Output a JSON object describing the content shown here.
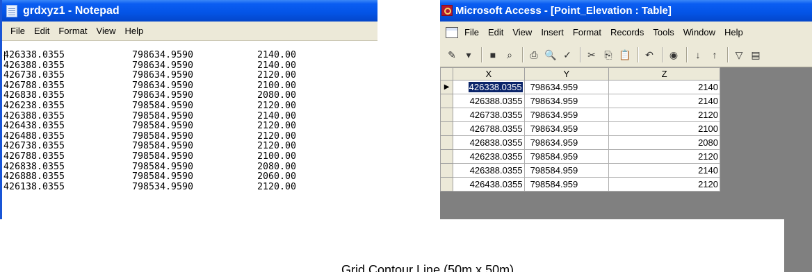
{
  "notepad": {
    "title": "grdxyz1 - Notepad",
    "menu": [
      "File",
      "Edit",
      "Format",
      "View",
      "Help"
    ],
    "rows": [
      [
        "426338.0355",
        "798634.9590",
        "2140.00"
      ],
      [
        "426388.0355",
        "798634.9590",
        "2140.00"
      ],
      [
        "426738.0355",
        "798634.9590",
        "2120.00"
      ],
      [
        "426788.0355",
        "798634.9590",
        "2100.00"
      ],
      [
        "426838.0355",
        "798634.9590",
        "2080.00"
      ],
      [
        "426238.0355",
        "798584.9590",
        "2120.00"
      ],
      [
        "426388.0355",
        "798584.9590",
        "2140.00"
      ],
      [
        "426438.0355",
        "798584.9590",
        "2120.00"
      ],
      [
        "426488.0355",
        "798584.9590",
        "2120.00"
      ],
      [
        "426738.0355",
        "798584.9590",
        "2120.00"
      ],
      [
        "426788.0355",
        "798584.9590",
        "2100.00"
      ],
      [
        "426838.0355",
        "798584.9590",
        "2080.00"
      ],
      [
        "426888.0355",
        "798584.9590",
        "2060.00"
      ],
      [
        "426138.0355",
        "798534.9590",
        "2120.00"
      ]
    ]
  },
  "access": {
    "title": "Microsoft Access - [Point_Elevation : Table]",
    "menu": [
      "File",
      "Edit",
      "View",
      "Insert",
      "Format",
      "Records",
      "Tools",
      "Window",
      "Help"
    ],
    "toolbar": [
      {
        "name": "design-view-icon",
        "glyph": "✎"
      },
      {
        "name": "view-dropdown-icon",
        "glyph": "▾"
      },
      {
        "name": "save-icon",
        "glyph": "■"
      },
      {
        "name": "search-db-icon",
        "glyph": "⌕"
      },
      {
        "name": "print-icon",
        "glyph": "⎙"
      },
      {
        "name": "print-preview-icon",
        "glyph": "🔍"
      },
      {
        "name": "spelling-icon",
        "glyph": "✓"
      },
      {
        "name": "cut-icon",
        "glyph": "✂"
      },
      {
        "name": "copy-icon",
        "glyph": "⎘"
      },
      {
        "name": "paste-icon",
        "glyph": "📋"
      },
      {
        "name": "undo-icon",
        "glyph": "↶"
      },
      {
        "name": "hyperlink-icon",
        "glyph": "◉"
      },
      {
        "name": "sort-ascending-icon",
        "glyph": "↓"
      },
      {
        "name": "sort-descending-icon",
        "glyph": "↑"
      },
      {
        "name": "filter-icon",
        "glyph": "▽"
      },
      {
        "name": "filter-form-icon",
        "glyph": "▤"
      }
    ],
    "columns": [
      "X",
      "Y",
      "Z"
    ],
    "rows": [
      [
        "426338.0355",
        "798634.959",
        "2140"
      ],
      [
        "426388.0355",
        "798634.959",
        "2140"
      ],
      [
        "426738.0355",
        "798634.959",
        "2120"
      ],
      [
        "426788.0355",
        "798634.959",
        "2100"
      ],
      [
        "426838.0355",
        "798634.959",
        "2080"
      ],
      [
        "426238.0355",
        "798584.959",
        "2120"
      ],
      [
        "426388.0355",
        "798584.959",
        "2140"
      ],
      [
        "426438.0355",
        "798584.959",
        "2120"
      ]
    ],
    "current_record_glyph": "▶"
  },
  "caption": {
    "text": "Grid Contour Line (50m x 50m)"
  }
}
